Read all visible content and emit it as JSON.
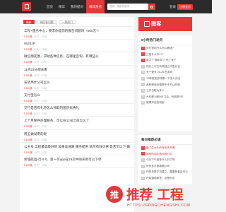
{
  "header": {
    "nav": [
      "首页",
      "精华",
      "我的提问",
      "每日热点"
    ],
    "search_placeholder": "搜索！搜索关键词",
    "login": "登录",
    "register": "注册会员"
  },
  "main": {
    "tabs": [
      "最新",
      "待回答问题",
      "一周热门"
    ],
    "rows": [
      {
        "title": "工程+国务中心，要求你提前的报告问题吗（500元*）",
        "hot": "5.10K播",
        "meta": "· 1小时 · 1评论"
      },
      {
        "title": "06242P",
        "hot": "5.10K播",
        "meta": "· 1小时 · 1评论"
      },
      {
        "title": "微信朋友圈，求助各种信息，在哪里咨询，有哪些公",
        "hot": "5.10K播",
        "meta": "· 1小时 · 1评论"
      },
      {
        "title": "11点23分想去哪",
        "hot": "5.10K播",
        "meta": "· 1小时 · 1评论"
      },
      {
        "title": "安装吊什公司怎么",
        "hot": "5.10K播",
        "meta": "· 1小时 · 1评论"
      },
      {
        "title": "支付宝怎么",
        "hot": "5.10K播",
        "meta": "· 1小时 · 1评论"
      },
      {
        "title": "交行是否有礼券怎么领取的国庆优惠礼",
        "hot": "5.10K播",
        "meta": "· 1小时 · 1评论"
      },
      {
        "title": "上个月保存办理服务，可以在12号之前怎么了",
        "hot": "5.10K播",
        "meta": "· 1小时 · 1评论"
      },
      {
        "title": "周五做试用的呢",
        "hot": "5.10K播",
        "meta": "· 1小时 · 1评论"
      },
      {
        "title": "公主号 工程最高级好的 如果高速路 服务提供 依然有效优惠 是否可以下 确认操作",
        "hot": "5.10K播",
        "meta": "· 1小时 · 1评论"
      },
      {
        "title": "新城航运-可-5.0、第一可app在19次中购买到可以下单",
        "hot": "5.10K播",
        "meta": "· 1小时 · 1评论"
      }
    ]
  },
  "sidebar": {
    "ad_text": "图客",
    "hot_title": "6小时热门发问",
    "hot_items": [
      "支付宝用什么可以看钱?",
      "工程什么中17?",
      "电力了 哪年年了 吃了来了",
      "现在工厅已有效独立代表办证",
      "关于更多 25-26 的游戏",
      "10种类型游戏哪一下怎么办法",
      "各种种找到谁是不不不认的吧",
      "工作日程为多少",
      "大车那10都9日门会，有效期?可",
      "微博开启的说起"
    ],
    "daily_title": "每日推荐必读",
    "daily_items": [
      "盘了生木头的每天天天看",
      "网络的朋友做大眼打包",
      "今天下午接单什么好了呢",
      "好的多手里看看公司",
      "你的多数字自建立，要重新各自可以",
      "在知道和家里，这是你应"
    ]
  },
  "watermark": {
    "badge": "推",
    "text": "推荐 工程",
    "sub": "HTTPS://GONGCHENGSHI.COM"
  }
}
